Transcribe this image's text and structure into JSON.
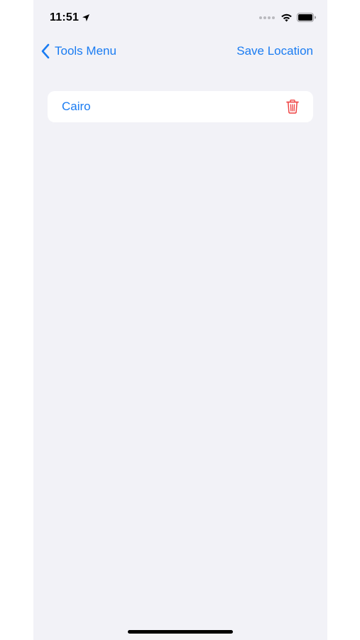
{
  "status_bar": {
    "time": "11:51"
  },
  "nav": {
    "back_label": "Tools Menu",
    "save_label": "Save Location"
  },
  "locations": [
    {
      "name": "Cairo"
    }
  ],
  "colors": {
    "accent": "#1a7cf2",
    "destructive": "#ef4444",
    "background": "#f2f2f7"
  },
  "icons": {
    "back": "chevron-left-icon",
    "delete": "trash-icon",
    "location": "location-arrow-icon",
    "wifi": "wifi-icon",
    "battery": "battery-icon"
  }
}
